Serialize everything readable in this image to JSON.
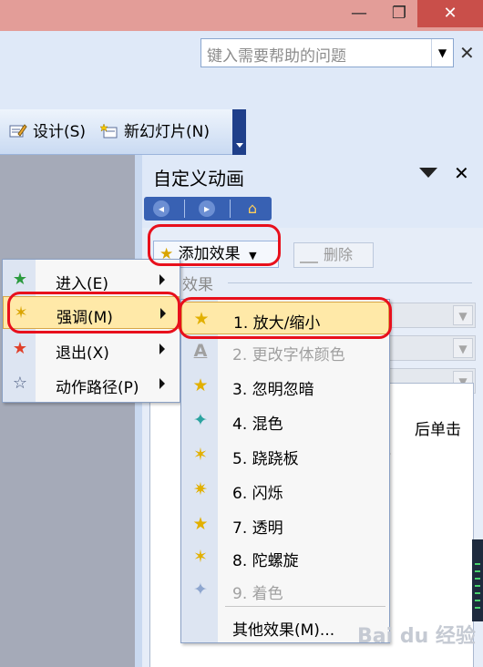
{
  "window": {
    "minimize_icon": "—",
    "maximize_icon": "❐",
    "close_icon": "✕"
  },
  "help": {
    "placeholder": "键入需要帮助的问题",
    "dropdown_icon": "▼",
    "close_icon": "✕"
  },
  "toolbar": {
    "design_label": "设计(S)",
    "new_slide_label": "新幻灯片(N)"
  },
  "task_pane": {
    "title": "自定义动画",
    "close_icon": "✕",
    "nav": {
      "back_icon": "◂",
      "forward_icon": "▸",
      "home_icon": "⌂"
    },
    "add_effect_label": "添加效果",
    "delete_label": "删除",
    "section_label": "效果",
    "list_text": "后单击",
    "list_text2": "."
  },
  "menu": {
    "items": [
      {
        "label": "进入(E)",
        "icon": "★",
        "icon_color": "#2b9a3e"
      },
      {
        "label": "强调(M)",
        "icon": "✶",
        "icon_color": "#d9a400"
      },
      {
        "label": "退出(X)",
        "icon": "★",
        "icon_color": "#e0402a"
      },
      {
        "label": "动作路径(P)",
        "icon": "☆",
        "icon_color": "#4a5b80"
      }
    ]
  },
  "submenu": {
    "items": [
      {
        "label": "1. 放大/缩小",
        "icon": "★"
      },
      {
        "label": "2. 更改字体颜色",
        "icon": "A"
      },
      {
        "label": "3. 忽明忽暗",
        "icon": "★"
      },
      {
        "label": "4. 混色",
        "icon": "✦"
      },
      {
        "label": "5. 跷跷板",
        "icon": "✶"
      },
      {
        "label": "6. 闪烁",
        "icon": "✷"
      },
      {
        "label": "7. 透明",
        "icon": "★"
      },
      {
        "label": "8. 陀螺旋",
        "icon": "✶"
      },
      {
        "label": "9. 着色",
        "icon": "✦"
      }
    ],
    "more_label": "其他效果(M)..."
  },
  "watermark": "Bai du 经验",
  "colors": {
    "titlebar": "#e39d98",
    "close": "#c94f4a",
    "highlight": "#ffe9a8",
    "annotation": "#e8101c"
  }
}
